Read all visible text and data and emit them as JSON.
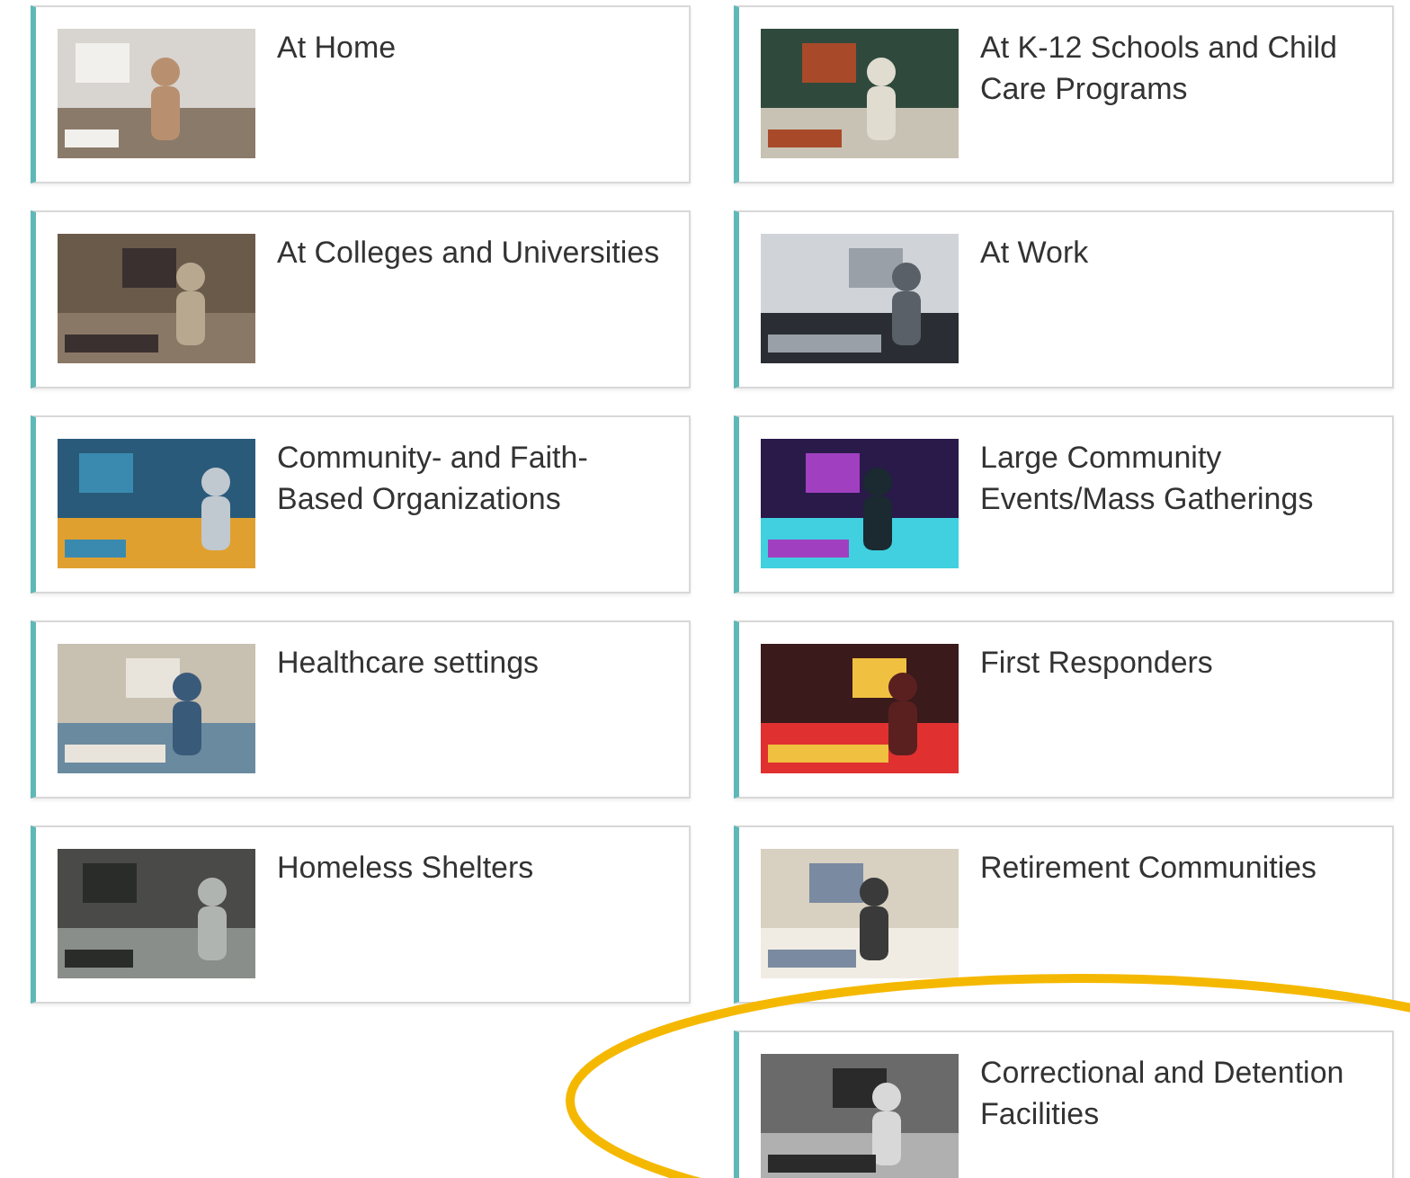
{
  "rows": [
    {
      "left": {
        "title": "At Home"
      },
      "right": {
        "title": "At K-12 Schools and Child Care Programs"
      }
    },
    {
      "left": {
        "title": "At Colleges and Universities"
      },
      "right": {
        "title": "At Work"
      }
    },
    {
      "left": {
        "title": "Community- and Faith-Based Organizations"
      },
      "right": {
        "title": "Large Community Events/Mass Gatherings"
      }
    },
    {
      "left": {
        "title": "Healthcare settings"
      },
      "right": {
        "title": "First Responders"
      }
    },
    {
      "left": {
        "title": "Homeless Shelters"
      },
      "right": {
        "title": "Retirement Communities"
      }
    },
    {
      "right": {
        "title": "Correctional and Detention Facilities"
      }
    }
  ],
  "annotation": {
    "kind": "ellipse"
  }
}
